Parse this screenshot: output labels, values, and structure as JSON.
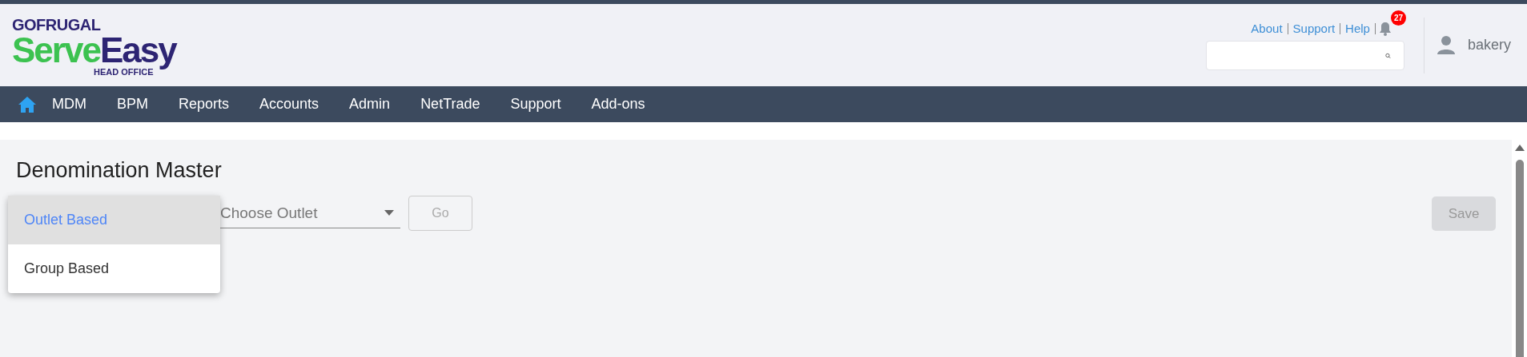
{
  "logo": {
    "brand": "GOFRUGAL",
    "product_first": "Serve",
    "product_second": "Easy",
    "edition": "HEAD OFFICE"
  },
  "header_links": [
    "About",
    "Support",
    "Help"
  ],
  "notifications": {
    "count": "27"
  },
  "user": {
    "name": "bakery"
  },
  "nav": {
    "items": [
      "MDM",
      "BPM",
      "Reports",
      "Accounts",
      "Admin",
      "NetTrade",
      "Support",
      "Add-ons"
    ]
  },
  "page": {
    "title": "Denomination Master",
    "type_options": [
      {
        "label": "Outlet Based",
        "selected": true
      },
      {
        "label": "Group Based",
        "selected": false
      }
    ],
    "outlet_select": {
      "placeholder": "Choose Outlet"
    },
    "go_button": {
      "label": "Go",
      "disabled": true
    },
    "save_button": {
      "label": "Save",
      "disabled": true
    }
  }
}
